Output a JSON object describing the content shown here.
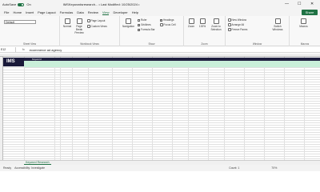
{
  "titlebar": {
    "autosave_label": "AutoSave",
    "autosave_state": "On",
    "filename": "IMSKeywordsresearch... • Last Modified: 10/25/2024 •",
    "minimize": "—",
    "maximize": "☐",
    "close": "✕"
  },
  "menu": {
    "items": [
      "File",
      "Home",
      "Insert",
      "Page Layout",
      "Formulas",
      "Data",
      "Review",
      "View",
      "Developer",
      "Help"
    ],
    "active": "View",
    "share_label": "Share"
  },
  "ribbon": {
    "sheet_view": {
      "dropdown": "Default",
      "group_label": "Sheet View"
    },
    "workbook_views": {
      "normal": "Normal",
      "page_break": "Page Break Preview",
      "page_layout": "Page Layout",
      "custom_views": "Custom Views",
      "group_label": "Workbook Views"
    },
    "show": {
      "navigation": "Navigation",
      "ruler": "Ruler",
      "gridlines": "Gridlines",
      "formula_bar": "Formula Bar",
      "headings": "Headings",
      "focus_cell": "Focus Cell",
      "group_label": "Show"
    },
    "zoom": {
      "zoom": "Zoom",
      "hundred": "100%",
      "zoom_selection": "Zoom to Selection",
      "group_label": "Zoom"
    },
    "window": {
      "new_window": "New Window",
      "arrange_all": "Arrange All",
      "freeze_panes": "Freeze Panes",
      "switch_windows": "Switch Windows",
      "group_label": "Window"
    },
    "macros": {
      "label": "Macros",
      "group_label": "Macros"
    }
  },
  "formula_bar": {
    "cell": "E12",
    "fx": "fx",
    "value": "ecommerce ad agency"
  },
  "sheet": {
    "logo_text": "IMS",
    "header_cell": "Keyword"
  },
  "sheet_tabs": [
    "Keyword Research"
  ],
  "statusbar": {
    "ready": "Ready",
    "accessibility": "Accessibility: Investigate",
    "count": "Count: 1",
    "zoom": "70%"
  },
  "colors": {
    "excel_green": "#1f7244",
    "dark_header": "#1f1f3f",
    "light_green": "#c9efd9"
  }
}
